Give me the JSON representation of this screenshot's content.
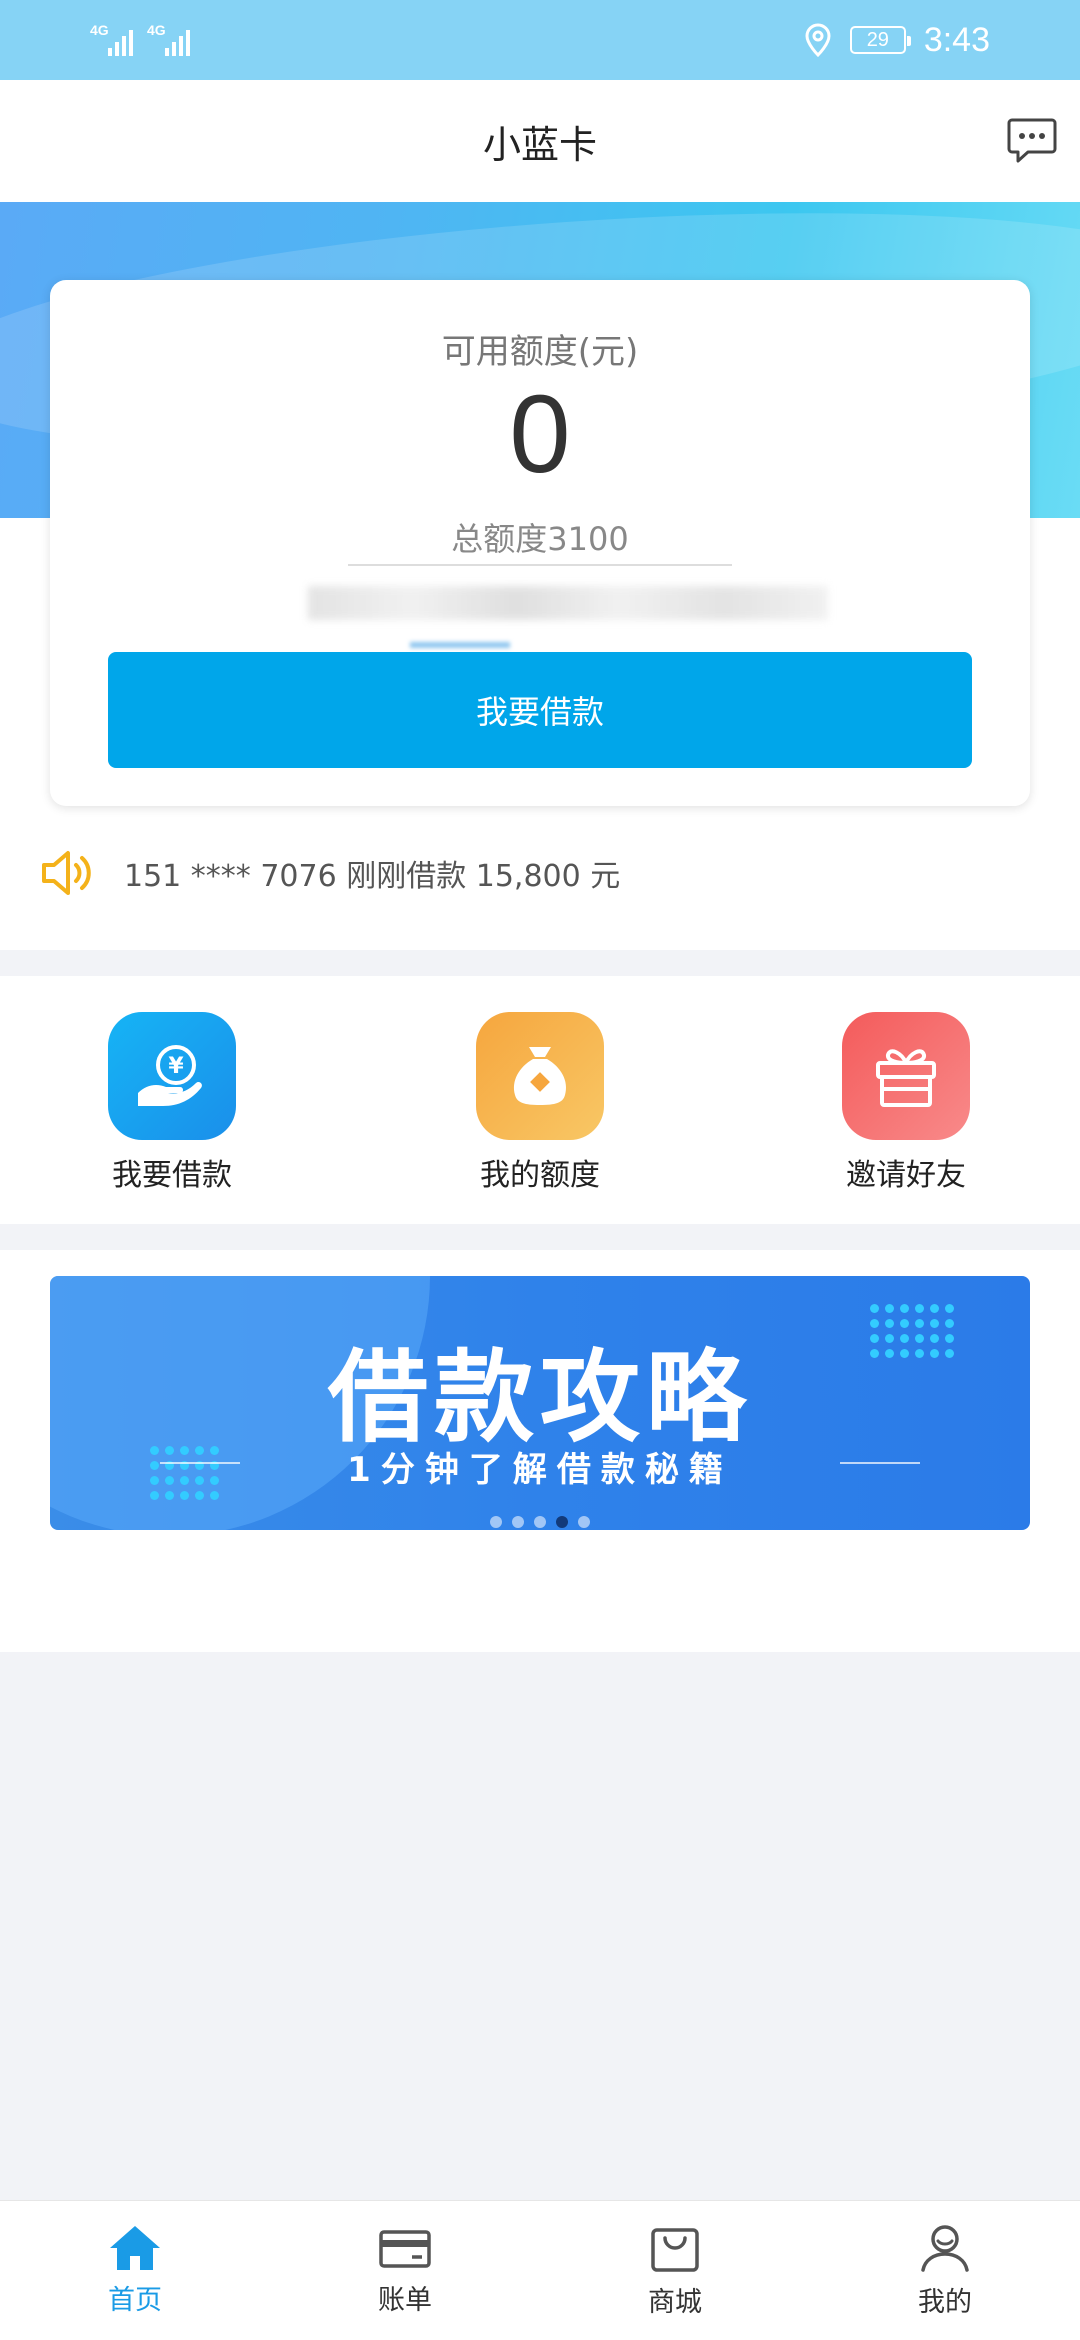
{
  "status_bar": {
    "signal_1": "4G",
    "signal_2": "4G",
    "battery_level": "29",
    "time": "3:43",
    "icons": [
      "signal-icon",
      "location-icon",
      "battery-icon"
    ]
  },
  "header": {
    "title": "小蓝卡",
    "message_icon": "chat-bubble-icon"
  },
  "quota_card": {
    "available_label": "可用额度(元)",
    "available_value": "0",
    "total_label": "总额度3100",
    "borrow_button": "我要借款"
  },
  "notice": {
    "icon": "speaker-icon",
    "text": "151 **** 7076 刚刚借款 15,800 元"
  },
  "shortcuts": [
    {
      "label": "我要借款",
      "icon": "yuan-hand-icon",
      "color": "#1aa7ee"
    },
    {
      "label": "我的额度",
      "icon": "money-bag-icon",
      "color": "#f7b24a"
    },
    {
      "label": "邀请好友",
      "icon": "gift-icon",
      "color": "#f46a6a"
    }
  ],
  "banner": {
    "title": "借款攻略",
    "subtitle": "1分钟了解借款秘籍",
    "pages": 5,
    "active_page": 4
  },
  "bottom_nav": [
    {
      "label": "首页",
      "icon": "home-icon",
      "active": true
    },
    {
      "label": "账单",
      "icon": "card-icon",
      "active": false
    },
    {
      "label": "商城",
      "icon": "shopping-bag-icon",
      "active": false
    },
    {
      "label": "我的",
      "icon": "user-icon",
      "active": false
    }
  ],
  "colors": {
    "accent": "#00a6ea",
    "status_bar": "#86d3f5",
    "nav_active": "#1a9be6"
  }
}
